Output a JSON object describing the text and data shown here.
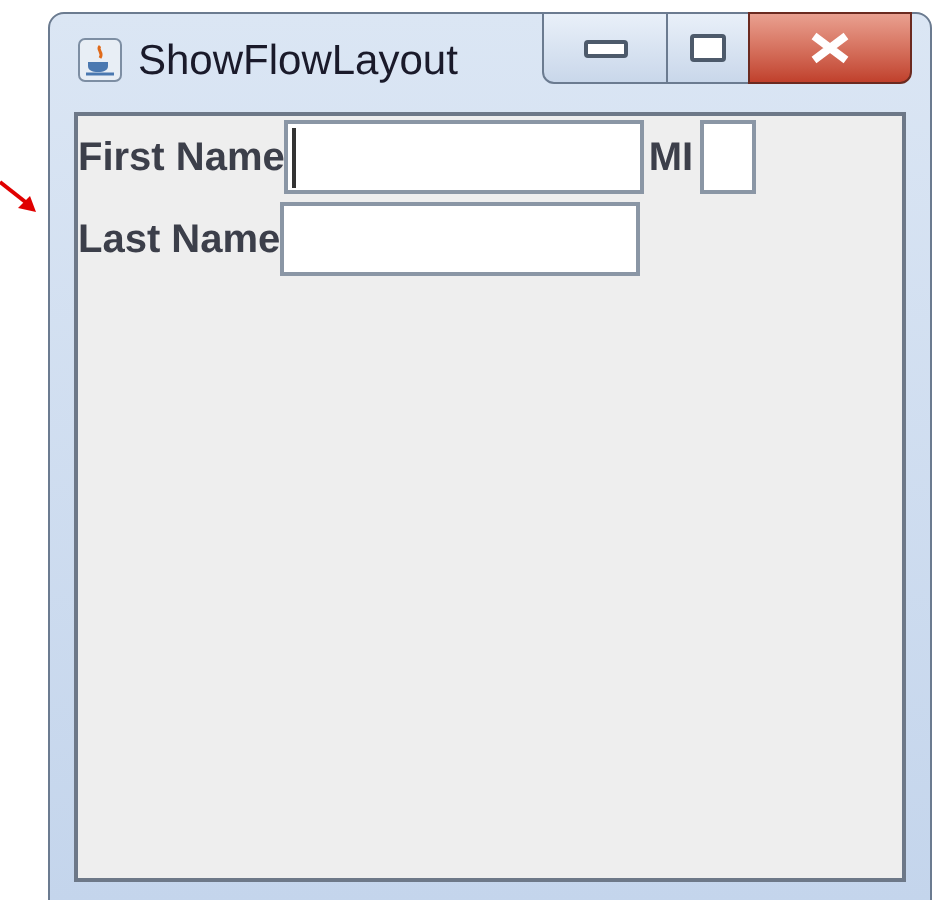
{
  "window": {
    "title": "ShowFlowLayout"
  },
  "rows": [
    {
      "fields": [
        {
          "label": "First Name",
          "kind": "name",
          "focused": true
        },
        {
          "label": "MI",
          "kind": "initial",
          "focused": false
        }
      ]
    },
    {
      "fields": [
        {
          "label": "Last Name",
          "kind": "name",
          "focused": false
        }
      ]
    }
  ]
}
